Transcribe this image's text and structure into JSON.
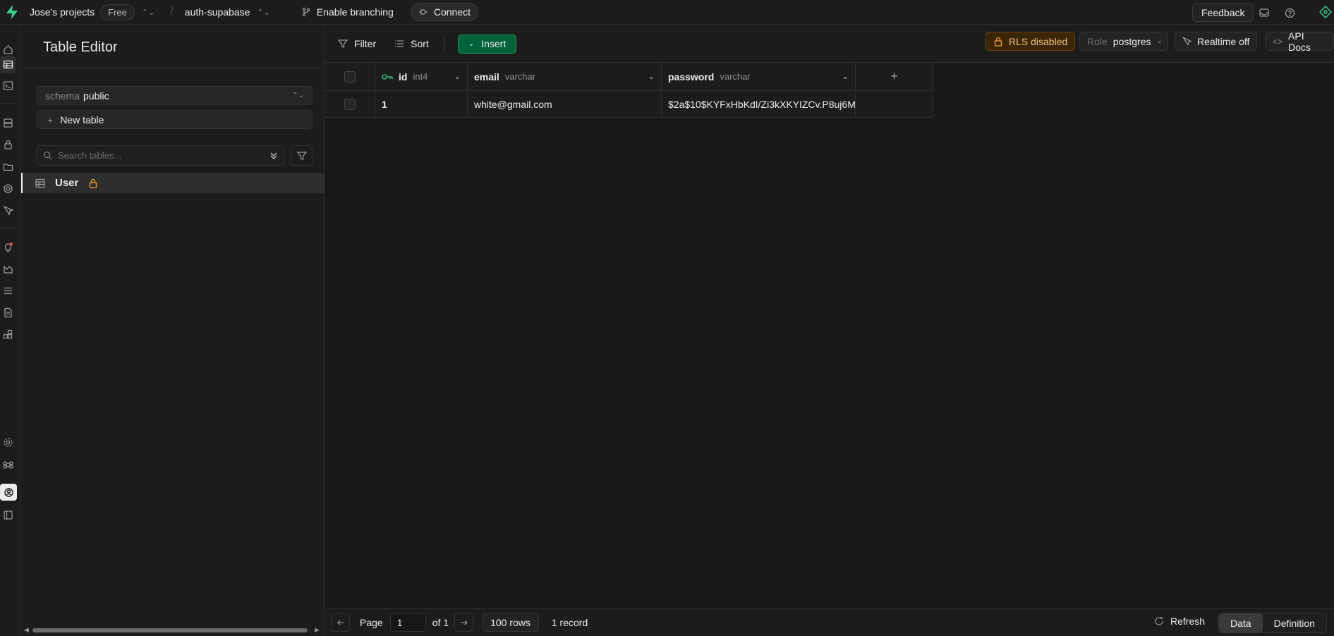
{
  "topbar": {
    "org_name": "Jose's projects",
    "plan_badge": "Free",
    "project_name": "auth-supabase",
    "branching_label": "Enable branching",
    "connect_label": "Connect",
    "feedback_label": "Feedback"
  },
  "sidebar": {
    "title": "Table Editor",
    "schema_label": "schema",
    "schema_value": "public",
    "new_table_label": "New table",
    "search_placeholder": "Search tables...",
    "tables": [
      {
        "name": "User",
        "rls_locked": true
      }
    ]
  },
  "toolbar": {
    "filter_label": "Filter",
    "sort_label": "Sort",
    "insert_label": "Insert",
    "rls_label": "RLS disabled",
    "role_label": "Role",
    "role_value": "postgres",
    "realtime_label": "Realtime off",
    "api_docs_label": "API Docs"
  },
  "grid": {
    "columns": [
      {
        "name": "id",
        "type": "int4",
        "primary_key": true
      },
      {
        "name": "email",
        "type": "varchar"
      },
      {
        "name": "password",
        "type": "varchar"
      }
    ],
    "rows": [
      {
        "id": "1",
        "email": "white@gmail.com",
        "password": "$2a$10$KYFxHbKdI/Zi3kXKYIZCv.P8uj6M"
      }
    ]
  },
  "footer": {
    "page_label": "Page",
    "page_value": "1",
    "of_label": "of 1",
    "rows_label": "100 rows",
    "record_count": "1 record",
    "refresh_label": "Refresh",
    "data_tab": "Data",
    "definition_tab": "Definition"
  },
  "colors": {
    "accent": "#3ecf8e",
    "insert_bg": "#006239",
    "rls_warning": "#f5a623",
    "background": "#1c1c1c"
  }
}
